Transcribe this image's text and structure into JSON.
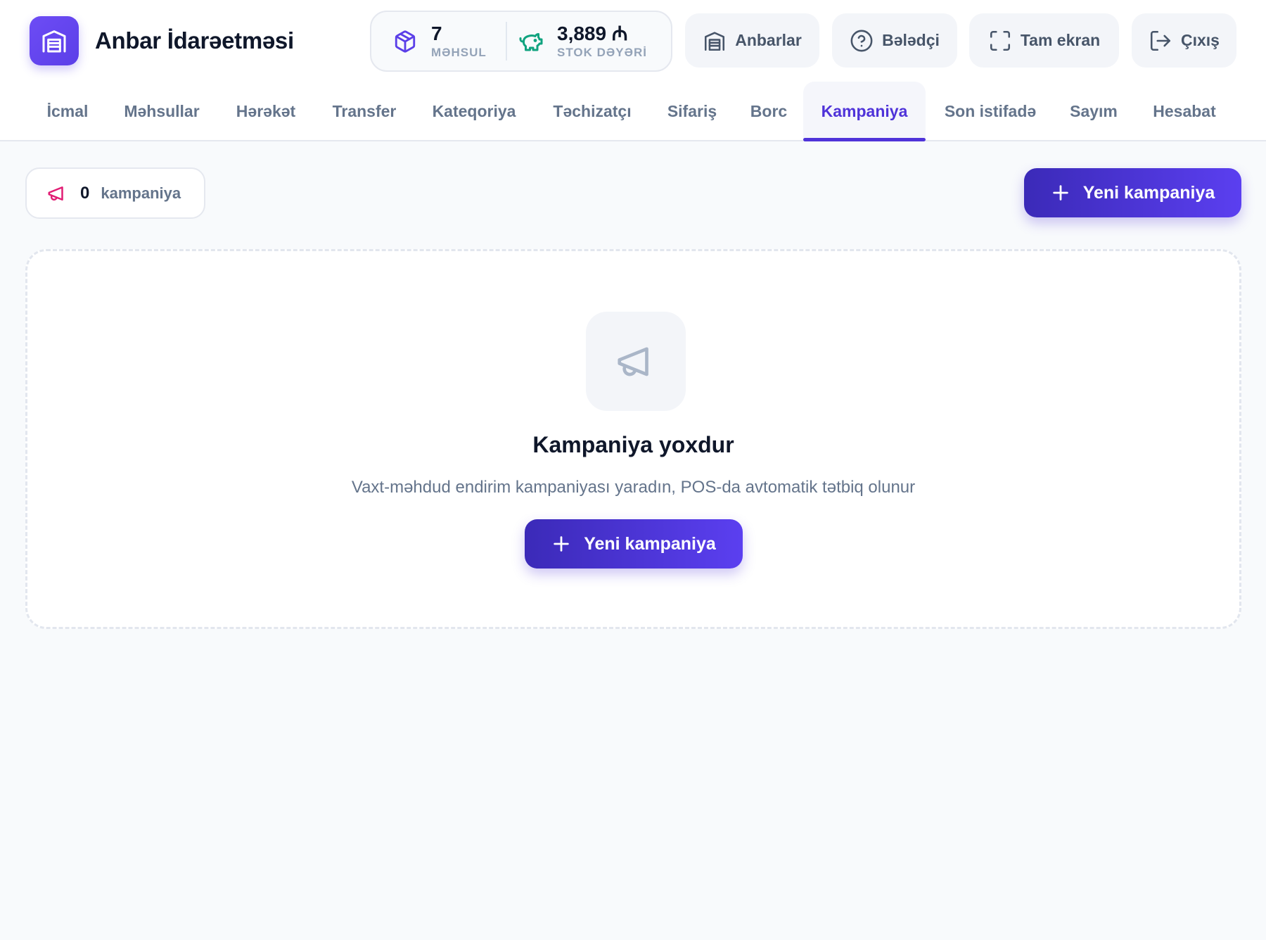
{
  "app": {
    "title": "Anbar İdarəetməsi",
    "accent_color": "#4f33d9",
    "logo_icon": "warehouse-icon"
  },
  "stats": [
    {
      "value": "7",
      "label": "MƏHSUL",
      "icon": "box-icon",
      "color": "#5b3fe8"
    },
    {
      "value": "3,889 ₼",
      "label": "STOK DƏYƏRİ",
      "icon": "piggy-bank-icon",
      "color": "#10a37f"
    }
  ],
  "header_buttons": {
    "warehouses": "Anbarlar",
    "guide": "Bələdçi",
    "fullscreen": "Tam ekran",
    "logout": "Çıxış"
  },
  "tabs": [
    {
      "label": "İcmal"
    },
    {
      "label": "Məhsullar"
    },
    {
      "label": "Hərəkət"
    },
    {
      "label": "Transfer"
    },
    {
      "label": "Kateqoriya"
    },
    {
      "label": "Təchizatçı"
    },
    {
      "label": "Sifariş"
    },
    {
      "label": "Borc"
    },
    {
      "label": "Kampaniya",
      "active": true
    },
    {
      "label": "Son istifadə"
    },
    {
      "label": "Sayım"
    },
    {
      "label": "Hesabat"
    }
  ],
  "campaigns": {
    "count": "0",
    "count_label": "kampaniya",
    "count_icon": "megaphone-icon",
    "new_button": "Yeni kampaniya",
    "empty_title": "Kampaniya yoxdur",
    "empty_description": "Vaxt-məhdud endirim kampaniyası yaradın, POS-da avtomatik tətbiq olunur",
    "empty_button": "Yeni kampaniya"
  }
}
